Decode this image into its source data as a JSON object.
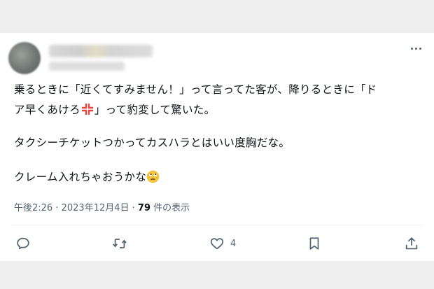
{
  "post": {
    "line1": "乗るときに「近くてすみません！」って言ってた客が、降りるときに「ド",
    "line2_a": "ア早くあけろ",
    "line2_b": "」って豹変して驚いた。",
    "line3": "タクシーチケットつかってカスハラとはいい度胸だな。",
    "line4": "クレーム入れちゃおうかな"
  },
  "meta": {
    "time": "午後2:26",
    "sep1": " · ",
    "date": "2023年12月4日",
    "sep2": " · ",
    "views_count": "79",
    "views_label": " 件の表示"
  },
  "actions": {
    "likes_count": "4"
  },
  "icons": {
    "more": "more-icon",
    "reply": "reply-icon",
    "retweet": "retweet-icon",
    "like": "heart-icon",
    "bookmark": "bookmark-icon",
    "share": "share-icon",
    "anger": "anger-symbol-icon",
    "face": "eye-roll-face-icon"
  },
  "colors": {
    "text": "#0f1419",
    "muted": "#536471",
    "anger": "#e8453c",
    "face": "#f5c33b"
  }
}
